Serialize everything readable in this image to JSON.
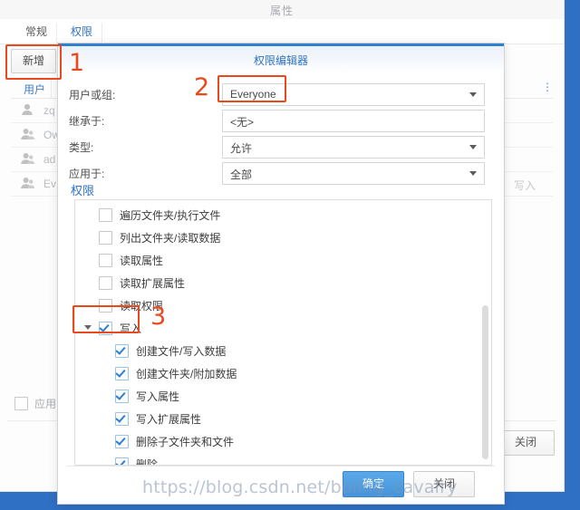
{
  "window": {
    "title": "属性",
    "tabs": [
      {
        "label": "常规",
        "active": false
      },
      {
        "label": "权限",
        "active": true
      }
    ],
    "add_button": "新增",
    "table": {
      "columns": [
        "用户"
      ],
      "rows": [
        {
          "name": "zq",
          "icon": "user-icon",
          "permission": ""
        },
        {
          "name": "Ow",
          "icon": "group-icon",
          "permission": ""
        },
        {
          "name": "ad",
          "icon": "group-icon",
          "permission": ""
        },
        {
          "name": "Ev",
          "icon": "group-icon",
          "permission": "写入"
        }
      ]
    },
    "kebab_icon": "more-vertical-icon",
    "apply_checkbox_label": "应用",
    "apply_checkbox_checked": false,
    "close_button": "关闭"
  },
  "dialog": {
    "title": "权限编辑器",
    "fields": [
      {
        "label": "用户或组:",
        "value": "Everyone",
        "type": "dropdown"
      },
      {
        "label": "继承于:",
        "value": "<无>",
        "type": "text"
      },
      {
        "label": "类型:",
        "value": "允许",
        "type": "dropdown"
      },
      {
        "label": "应用于:",
        "value": "全部",
        "type": "dropdown"
      }
    ],
    "permissions_section_label": "权限",
    "permissions": [
      {
        "label": "遍历文件夹/执行文件",
        "checked": false,
        "level": 0,
        "expander": false
      },
      {
        "label": "列出文件夹/读取数据",
        "checked": false,
        "level": 0,
        "expander": false
      },
      {
        "label": "读取属性",
        "checked": false,
        "level": 0,
        "expander": false
      },
      {
        "label": "读取扩展属性",
        "checked": false,
        "level": 0,
        "expander": false
      },
      {
        "label": "读取权限",
        "checked": false,
        "level": 0,
        "expander": false
      },
      {
        "label": "写入",
        "checked": true,
        "level": 0,
        "expander": true
      },
      {
        "label": "创建文件/写入数据",
        "checked": true,
        "level": 1,
        "expander": false
      },
      {
        "label": "创建文件夹/附加数据",
        "checked": true,
        "level": 1,
        "expander": false
      },
      {
        "label": "写入属性",
        "checked": true,
        "level": 1,
        "expander": false
      },
      {
        "label": "写入扩展属性",
        "checked": true,
        "level": 1,
        "expander": false
      },
      {
        "label": "删除子文件夹和文件",
        "checked": true,
        "level": 1,
        "expander": false
      },
      {
        "label": "删除",
        "checked": true,
        "level": 1,
        "expander": false
      }
    ],
    "ok_button": "确定",
    "close_button": "关闭"
  },
  "annotations": [
    {
      "number": "1",
      "target": "新增"
    },
    {
      "number": "2",
      "target": "Everyone"
    },
    {
      "number": "3",
      "target": "写入"
    }
  ],
  "watermark": "https://blog.csdn.net/boling_cavalry",
  "colors": {
    "accent_blue": "#2f72c4",
    "annotation_red": "#e8491d",
    "primary_button": "#4594dc",
    "desktop": "#2f6fc4"
  }
}
